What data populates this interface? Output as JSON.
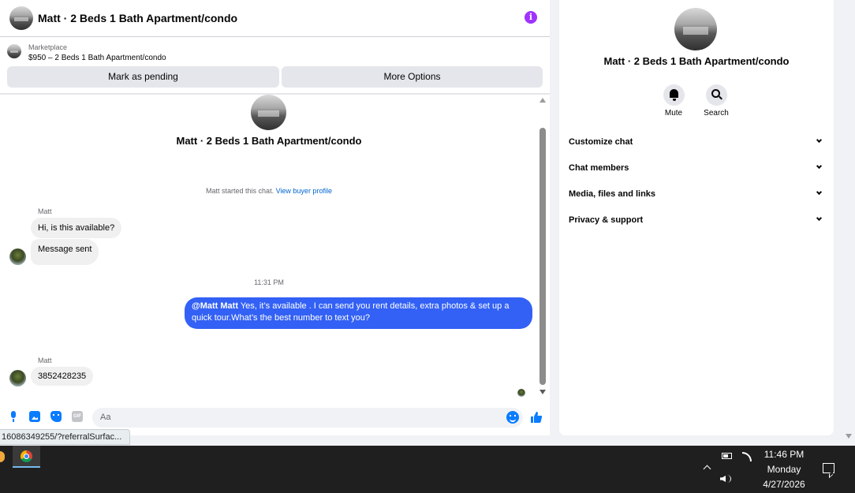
{
  "header": {
    "title": "Matt · 2 Beds 1 Bath Apartment/condo"
  },
  "listing": {
    "label": "Marketplace",
    "price_line": "$950 – 2 Beds 1 Bath Apartment/condo"
  },
  "actions": {
    "pending": "Mark as pending",
    "more": "More Options"
  },
  "conversation": {
    "title": "Matt · 2 Beds 1 Bath Apartment/condo",
    "started_text": "Matt started this chat. ",
    "buyer_link": "View buyer profile",
    "sender_1": "Matt",
    "msg_1": "Hi, is this available?",
    "msg_2": "Message sent",
    "time": "11:31 PM",
    "out_mention": "@Matt Matt",
    "out_text": " Yes, it’s available .  I can send you rent details, extra photos & set up a quick tour.What’s the best number to text you?",
    "sender_2": "Matt",
    "msg_3": "3852428235"
  },
  "composer": {
    "placeholder": "Aa",
    "gif_label": "GIF"
  },
  "info_panel": {
    "title": "Matt · 2 Beds 1 Bath Apartment/condo",
    "mute_label": "Mute",
    "search_label": "Search",
    "sections": [
      "Customize chat",
      "Chat members",
      "Media, files and links",
      "Privacy & support"
    ]
  },
  "status_url": "16086349255/?referralSurfac...",
  "taskbar": {
    "time": "11:46 PM",
    "day": "Monday",
    "date": "4/27/2026"
  },
  "colors": {
    "accent": "#3361f5",
    "info_icon": "#a033ff",
    "link": "#0064d1"
  }
}
